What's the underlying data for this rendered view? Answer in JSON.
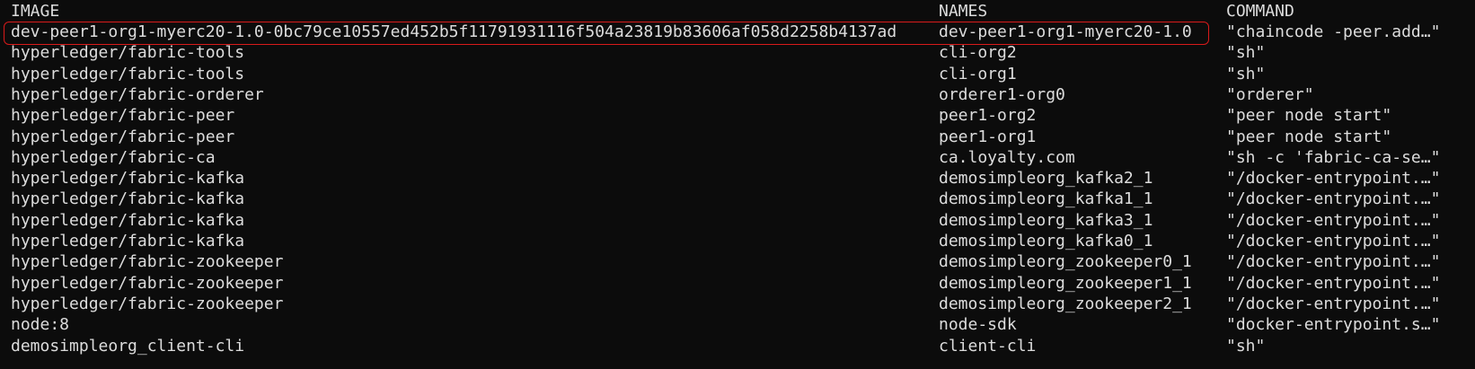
{
  "headers": {
    "image": "IMAGE",
    "names": "NAMES",
    "command": "COMMAND"
  },
  "rows": [
    {
      "image": "dev-peer1-org1-myerc20-1.0-0bc79ce10557ed452b5f11791931116f504a23819b83606af058d2258b4137ad",
      "names": "dev-peer1-org1-myerc20-1.0",
      "command": "\"chaincode -peer.add…\""
    },
    {
      "image": "hyperledger/fabric-tools",
      "names": "cli-org2",
      "command": "\"sh\""
    },
    {
      "image": "hyperledger/fabric-tools",
      "names": "cli-org1",
      "command": "\"sh\""
    },
    {
      "image": "hyperledger/fabric-orderer",
      "names": "orderer1-org0",
      "command": "\"orderer\""
    },
    {
      "image": "hyperledger/fabric-peer",
      "names": "peer1-org2",
      "command": "\"peer node start\""
    },
    {
      "image": "hyperledger/fabric-peer",
      "names": "peer1-org1",
      "command": "\"peer node start\""
    },
    {
      "image": "hyperledger/fabric-ca",
      "names": "ca.loyalty.com",
      "command": "\"sh -c 'fabric-ca-se…\""
    },
    {
      "image": "hyperledger/fabric-kafka",
      "names": "demosimpleorg_kafka2_1",
      "command": "\"/docker-entrypoint.…\""
    },
    {
      "image": "hyperledger/fabric-kafka",
      "names": "demosimpleorg_kafka1_1",
      "command": "\"/docker-entrypoint.…\""
    },
    {
      "image": "hyperledger/fabric-kafka",
      "names": "demosimpleorg_kafka3_1",
      "command": "\"/docker-entrypoint.…\""
    },
    {
      "image": "hyperledger/fabric-kafka",
      "names": "demosimpleorg_kafka0_1",
      "command": "\"/docker-entrypoint.…\""
    },
    {
      "image": "hyperledger/fabric-zookeeper",
      "names": "demosimpleorg_zookeeper0_1",
      "command": "\"/docker-entrypoint.…\""
    },
    {
      "image": "hyperledger/fabric-zookeeper",
      "names": "demosimpleorg_zookeeper1_1",
      "command": "\"/docker-entrypoint.…\""
    },
    {
      "image": "hyperledger/fabric-zookeeper",
      "names": "demosimpleorg_zookeeper2_1",
      "command": "\"/docker-entrypoint.…\""
    },
    {
      "image": "node:8",
      "names": "node-sdk",
      "command": "\"docker-entrypoint.s…\""
    },
    {
      "image": "demosimpleorg_client-cli",
      "names": "client-cli",
      "command": "\"sh\""
    }
  ],
  "colors": {
    "background": "#0c0c0c",
    "text": "#dcdcdc",
    "highlight_border": "#d91a1a"
  }
}
